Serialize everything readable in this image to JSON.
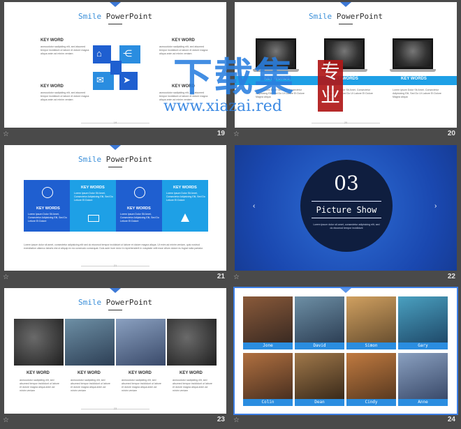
{
  "slides": {
    "s19": {
      "number": "19",
      "title_a": "Smile",
      "title_b": "PowerPoint",
      "page": "19",
      "kw_tl": "KEY WORD",
      "kw_tr": "KEY WORD",
      "kw_bl": "KEY WORD",
      "kw_br": "KEY WORD",
      "body": "asmoodutor sadipiding elit, sed alsumed tempor incididunt ut labore et dolore magna aliqua anim ad minim veniam"
    },
    "s20": {
      "number": "20",
      "title_a": "Smile",
      "title_b": "PowerPoint",
      "page": "20",
      "kw": [
        "KEY WORDS",
        "KEY WORDS",
        "KEY WORDS"
      ],
      "body": "Lorem ipsum Dolor Sit Amet, Consectetur Adipisicing Elit, Sed Do Ut Labore Et Dolore Magna aliqua"
    },
    "s21": {
      "number": "21",
      "title_a": "Smile",
      "title_b": "PowerPoint",
      "page": "21",
      "kw": [
        "KEY WORDS",
        "KEY WORDS",
        "KEY WORDS",
        "KEY WORDS"
      ],
      "panel_text": "Lorem Ipsum Dolor Sit Amet, Consectetur Adipisicing Elit, Sed Do Lebore Et Dolore",
      "footer_text": "Lorem ipsum dolor sit amet, consectetur adipisicing elit sed do eiusmod tempor incididunt ut labore et dolore magna aliqua. Ut enim ad minim veniam, quis nostrud exercitation ullamco laboris nisi ut aliquip ex ea commodo consequat. Duis aute irure dolor in reprehenderit in voluptate velit esse cillum dolore eu fugiat nulla pariatur."
    },
    "s22": {
      "number": "22",
      "big": "03",
      "subtitle": "Picture Show",
      "text": "Lorem ipsum dolor sit amet, consectetur adipisicing elit, sed do eiusmod tempor incididunt"
    },
    "s23": {
      "number": "23",
      "title_a": "Smile",
      "title_b": "PowerPoint",
      "page": "23",
      "kw": [
        "KEY WORD",
        "KEY WORD",
        "KEY WORD",
        "KEY WORD"
      ],
      "body": "asmoodutor sadipiding elit, sed alsumed tempor incididunt ut labore et dolore magna aliqua anim ad minim veniam"
    },
    "s24": {
      "number": "24",
      "names": [
        "Jone",
        "David",
        "Simon",
        "Gary",
        "Colin",
        "Dean",
        "Cindy",
        "Anne"
      ]
    }
  },
  "watermark": {
    "big": "下载集",
    "red": "专业",
    "url": "www.xiazai.red"
  },
  "colors": {
    "accent": "#2a8de0",
    "dark_blue": "#1a4fb0",
    "cyan": "#1ea0e6",
    "frame": "#4a4a4a"
  },
  "icons": [
    "star-icon",
    "home-icon",
    "share-icon",
    "chat-icon",
    "send-icon",
    "search-icon",
    "gauge-icon",
    "battery-icon",
    "cone-icon",
    "left-arrow-icon",
    "right-arrow-icon"
  ]
}
